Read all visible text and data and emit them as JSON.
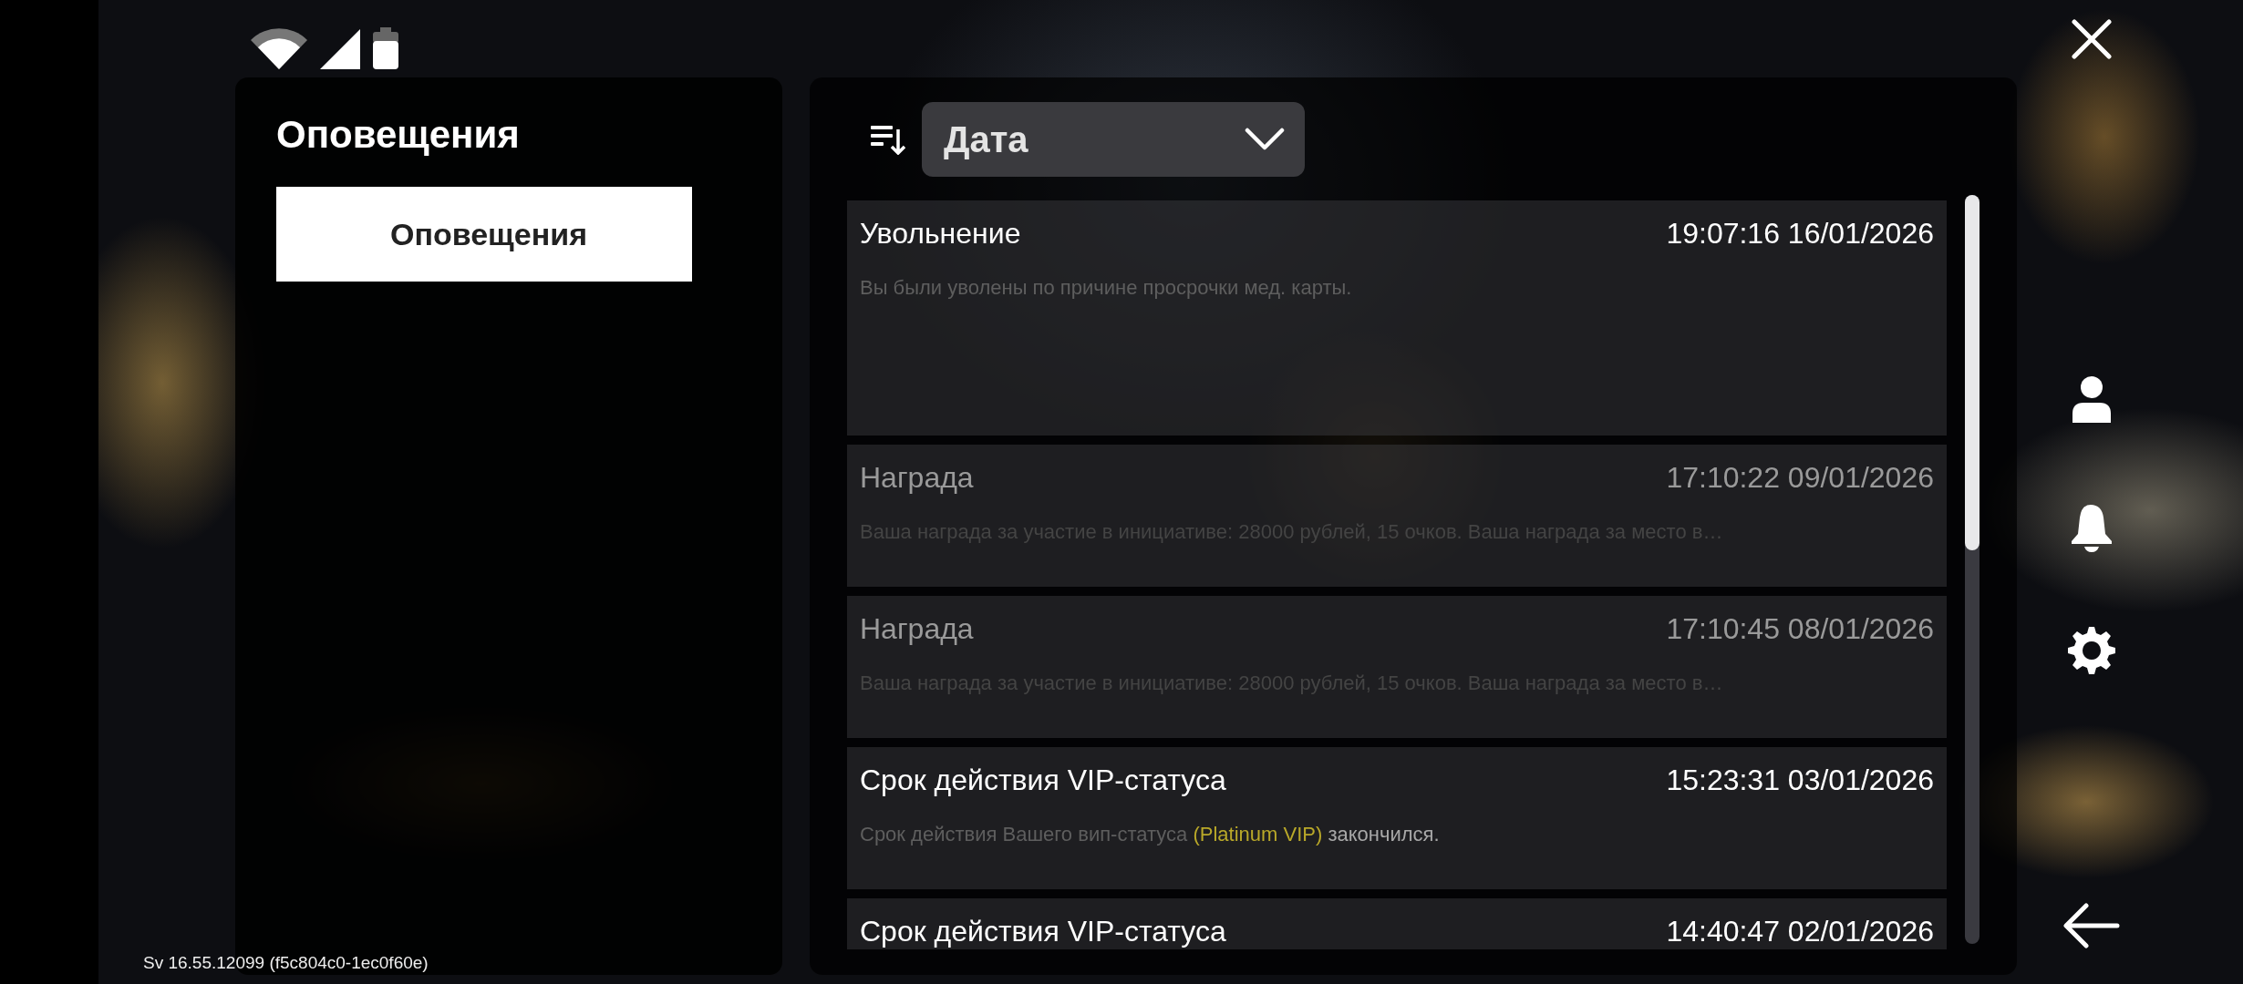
{
  "sidebar": {
    "title": "Оповещения",
    "items": [
      {
        "label": "Оповещения",
        "selected": true
      }
    ]
  },
  "sort": {
    "value": "Дата"
  },
  "notifications": [
    {
      "title": "Увольнение",
      "time": "19:07:16 16/01/2026",
      "read": false,
      "expanded": true,
      "body": [
        {
          "kind": "muted",
          "text": "Вы были уволены по причине просрочки мед. карты."
        }
      ]
    },
    {
      "title": "Награда",
      "time": "17:10:22 09/01/2026",
      "read": true,
      "expanded": false,
      "body": [
        {
          "kind": "muted",
          "text": "Ваша награда за участие в инициативе: 28000 рублей, 15 очков. Ваша награда за место в…"
        }
      ]
    },
    {
      "title": "Награда",
      "time": "17:10:45 08/01/2026",
      "read": true,
      "expanded": false,
      "body": [
        {
          "kind": "muted",
          "text": "Ваша награда за участие в инициативе: 28000 рублей, 15 очков. Ваша награда за место в…"
        }
      ]
    },
    {
      "title": "Срок действия VIP-статуса",
      "time": "15:23:31 03/01/2026",
      "read": false,
      "expanded": false,
      "body": [
        {
          "kind": "muted",
          "text": "Срок действия Вашего вип-статуса "
        },
        {
          "kind": "highlight",
          "text": "(Platinum VIP)"
        },
        {
          "kind": "plain",
          "text": " закончился."
        }
      ]
    },
    {
      "title": "Срок действия VIP-статуса",
      "time": "14:40:47 02/01/2026",
      "read": false,
      "expanded": false
    }
  ],
  "version": "Sv 16.55.12099 (f5c804c0-1ec0f60e)"
}
